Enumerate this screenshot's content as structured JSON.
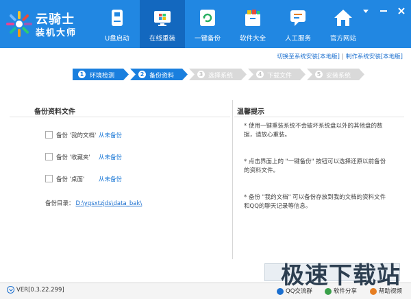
{
  "app": {
    "logo_line1": "云骑士",
    "logo_line2": "装机大师"
  },
  "nav": [
    {
      "label": "U盘启动",
      "icon": "usb-drive-icon"
    },
    {
      "label": "在线重装",
      "icon": "windows-icon",
      "active": true
    },
    {
      "label": "一键备份",
      "icon": "refresh-backup-icon"
    },
    {
      "label": "软件大全",
      "icon": "software-box-icon"
    },
    {
      "label": "人工服务",
      "icon": "chat-service-icon"
    },
    {
      "label": "官方网站",
      "icon": "home-icon"
    }
  ],
  "window_controls": [
    "menu-dropdown-icon",
    "minimize-icon",
    "close-icon"
  ],
  "links": {
    "switch_to_local": "切换至系统安装[本地版]",
    "separator": "|",
    "make_installer": "制作系统安装[本地版]"
  },
  "steps": [
    {
      "num": "1",
      "label": "环境检测",
      "state": "done"
    },
    {
      "num": "2",
      "label": "备份资料",
      "state": "active"
    },
    {
      "num": "3",
      "label": "选择系统",
      "state": "pending"
    },
    {
      "num": "4",
      "label": "下载文件",
      "state": "pending"
    },
    {
      "num": "5",
      "label": "安装系统",
      "state": "pending"
    }
  ],
  "backup": {
    "title": "备份资料文件",
    "items": [
      {
        "label": "备份 '我的文档'",
        "status": "从未备份",
        "checked": false
      },
      {
        "label": "备份 '收藏夹'",
        "status": "从未备份",
        "checked": false
      },
      {
        "label": "备份 '桌面'",
        "status": "从未备份",
        "checked": false
      }
    ],
    "dir_label": "备份目录：",
    "dir_value": "D:\\yqsxtzjds\\data_bak\\"
  },
  "tips": {
    "title": "温馨提示",
    "items": [
      "* 使用一键重装系统不会破坏系统盘以外的其他盘的数据，请放心重装。",
      "* 点击界面上的 \"一键备份\" 按钮可以选择还原以前备份的资料文件。",
      "* 备份 \"我的文档\" 可以备份存放到我的文档的资料文件和QQ的聊天记录等信息。"
    ]
  },
  "footer": {
    "version": "VER[0.3.22.299]",
    "qq_group": "QQ交流群",
    "share": "软件分享",
    "help": "帮助视频"
  },
  "watermark": "极速下载站",
  "colors": {
    "header": "#2187e2",
    "active_tab": "#1368bf",
    "step_active": "#1a7fde",
    "step_pending": "#d9d9d9",
    "link": "#1b6fcf"
  }
}
